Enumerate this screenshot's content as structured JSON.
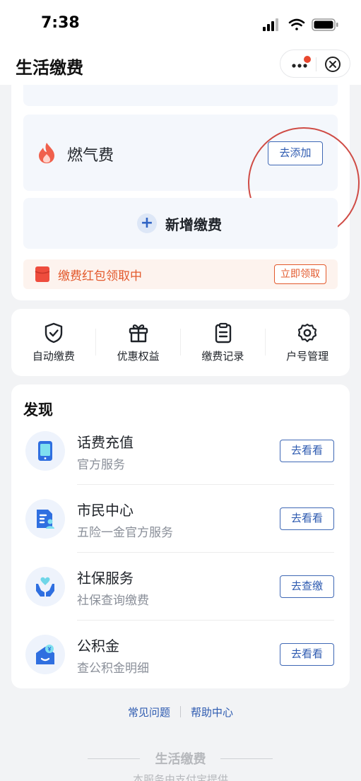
{
  "status_bar": {
    "time": "7:38"
  },
  "header": {
    "title": "生活缴费",
    "more_icon": "more-dots-icon",
    "close_icon": "close-circle-icon"
  },
  "bills": {
    "gas": {
      "label": "燃气费",
      "button": "去添加",
      "icon": "flame-icon"
    },
    "new_bill": {
      "label": "新增缴费",
      "icon": "plus-icon"
    },
    "promo": {
      "label": "缴费红包领取中",
      "button": "立即领取",
      "icon": "red-envelope-icon"
    }
  },
  "quick_actions": [
    {
      "label": "自动缴费",
      "icon": "shield-check-icon"
    },
    {
      "label": "优惠权益",
      "icon": "gift-icon"
    },
    {
      "label": "缴费记录",
      "icon": "clipboard-icon"
    },
    {
      "label": "户号管理",
      "icon": "gear-icon"
    }
  ],
  "discover": {
    "title": "发现",
    "items": [
      {
        "name": "话费充值",
        "subtitle": "官方服务",
        "button": "去看看",
        "icon": "phone-icon"
      },
      {
        "name": "市民中心",
        "subtitle": "五险一金官方服务",
        "button": "去看看",
        "icon": "citizen-card-icon"
      },
      {
        "name": "社保服务",
        "subtitle": "社保查询缴费",
        "button": "去查缴",
        "icon": "hands-heart-icon"
      },
      {
        "name": "公积金",
        "subtitle": "查公积金明细",
        "button": "去看看",
        "icon": "house-fund-icon"
      }
    ]
  },
  "footer": {
    "faq": "常见问题",
    "help": "帮助中心",
    "brand": "生活缴费",
    "provider": "本服务由支付宝提供"
  },
  "colors": {
    "accent": "#2d5ab0",
    "promo": "#e3592c",
    "annotation_circle": "#cf4b45"
  }
}
